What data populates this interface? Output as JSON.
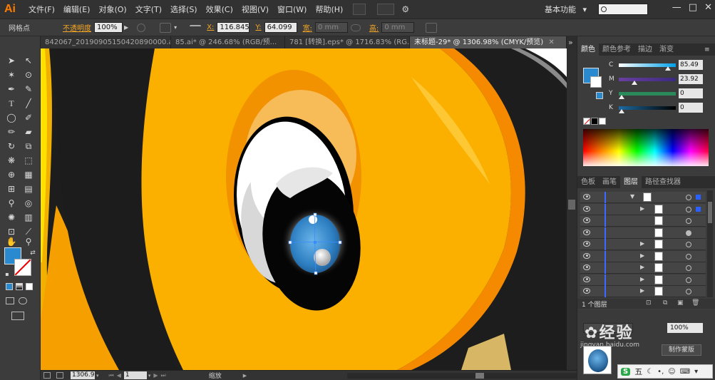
{
  "app": {
    "logo": "Ai",
    "menu": [
      "文件(F)",
      "编辑(E)",
      "对象(O)",
      "文字(T)",
      "选择(S)",
      "效果(C)",
      "视图(V)",
      "窗口(W)",
      "帮助(H)"
    ],
    "workspace": "基本功能",
    "workspace_arrow": "▾",
    "window_buttons": [
      "—",
      "□",
      "✕"
    ]
  },
  "control_bar": {
    "selection_label": "网格点",
    "opacity_label": "不透明度",
    "opacity_value": "100%",
    "x_label": "X:",
    "x_value": "116.845",
    "y_label": "Y:",
    "y_value": "64.099",
    "width_label": "宽:",
    "width_value": "0 mm",
    "height_label": "高:",
    "height_value": "0 mm"
  },
  "tabs": [
    {
      "label": "842067_20190905150420890000.ai*",
      "active": false
    },
    {
      "label": "85.ai* @ 246.68% (RGB/预...",
      "active": false
    },
    {
      "label": "781 [转换].eps* @ 1716.83% (RG...",
      "active": false
    },
    {
      "label": "未标题-29* @ 1306.98% (CMYK/预览)",
      "active": true
    }
  ],
  "tabs_overflow": "»",
  "status_bar": {
    "zoom": "1306.9",
    "page": "1",
    "tool_name": "缩放"
  },
  "color_panel": {
    "tabs": [
      "颜色",
      "颜色参考",
      "描边",
      "渐变"
    ],
    "active_tab": "颜色",
    "channels": [
      {
        "label": "C",
        "value": "85.49",
        "gradient": [
          "#ffffff",
          "#00a0e9"
        ],
        "fraction": 0.85
      },
      {
        "label": "M",
        "value": "23.92",
        "gradient": [
          "#6a3fa0",
          "#3b2a80"
        ],
        "fraction": 0.24
      },
      {
        "label": "Y",
        "value": "0",
        "gradient": [
          "#2a8a5a",
          "#2a8a5a"
        ],
        "fraction": 0.0
      },
      {
        "label": "K",
        "value": "0",
        "gradient": [
          "#1c6aa0",
          "#000000"
        ],
        "fraction": 0.0
      }
    ],
    "fill_color": "#2a8ad0"
  },
  "layers_panel": {
    "tabs": [
      "色板",
      "画笔",
      "图层",
      "路径查找器"
    ],
    "active_tab": "图层",
    "footer": "1 个图层",
    "rows": 9
  },
  "bottom_panel": {
    "opacity_value": "100%",
    "button_label": "制作蒙版"
  },
  "watermark": {
    "text": "经验",
    "site": "jingyan.baidu.com"
  },
  "ime_toolbar": {
    "logo": "S",
    "mode": "五"
  }
}
